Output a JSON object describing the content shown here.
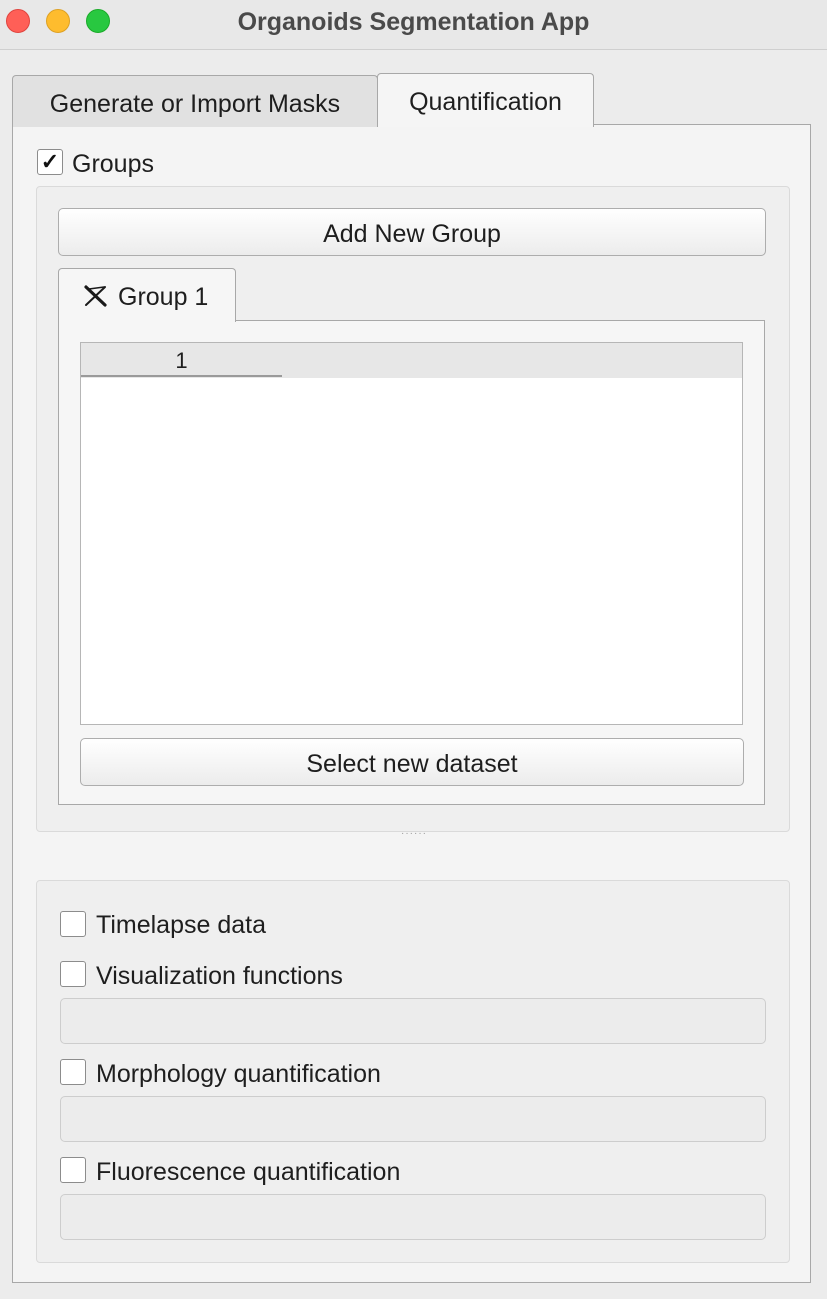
{
  "window": {
    "title": "Organoids Segmentation App"
  },
  "tabs": [
    {
      "label": "Generate or Import Masks",
      "active": false
    },
    {
      "label": "Quantification",
      "active": true
    }
  ],
  "groups": {
    "checkbox_label": "Groups",
    "checked": true,
    "add_button_label": "Add New Group",
    "tabs": [
      {
        "label": "Group 1",
        "close_icon": "close-icon"
      }
    ],
    "table": {
      "column_headers": [
        "1"
      ]
    },
    "select_dataset_label": "Select new dataset"
  },
  "options": [
    {
      "label": "Timelapse data",
      "checked": false
    },
    {
      "label": "Visualization functions",
      "checked": false
    },
    {
      "label": "Morphology quantification",
      "checked": false
    },
    {
      "label": "Fluorescence quantification",
      "checked": false
    }
  ],
  "colors": {
    "close_light": "#ff5f57",
    "minimize_light": "#febc2e",
    "maximize_light": "#28c840"
  }
}
